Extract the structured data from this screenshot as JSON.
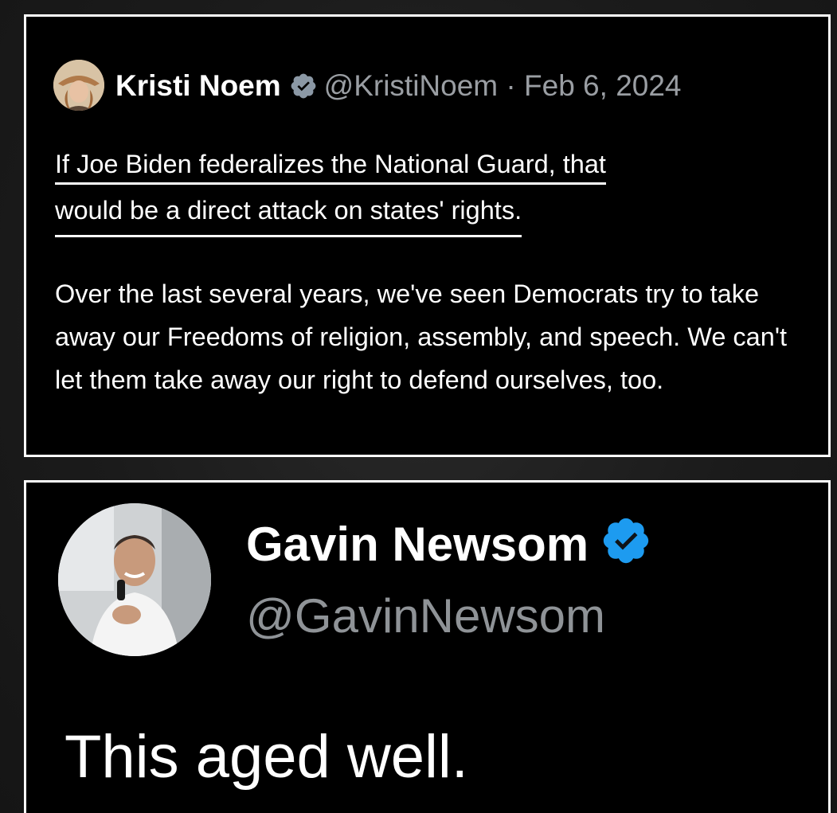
{
  "tweets": [
    {
      "author_name": "Kristi Noem",
      "verified": true,
      "handle_and_date": "@KristiNoem · Feb 6, 2024",
      "body_line1": "If Joe Biden federalizes the National Guard, that",
      "body_line2": "would be a direct attack on states' rights.",
      "body_paragraph2": "Over the last several years, we've seen Democrats try to take away our Freedoms of religion, assembly, and speech. We can't let them take away our right to defend ourselves, too."
    },
    {
      "author_name": "Gavin Newsom",
      "verified": true,
      "handle": "@GavinNewsom",
      "body": "This aged well."
    }
  ],
  "icons": {
    "badge_top": "verified-badge-icon (gray)",
    "badge_bottom": "verified-badge-icon (blue)"
  },
  "colors": {
    "card_background": "#000000",
    "card_border": "#ffffff",
    "handle_gray": "#9a9ea3",
    "verified_blue": "#1d9bf0",
    "verified_gray": "#8b98a5"
  }
}
